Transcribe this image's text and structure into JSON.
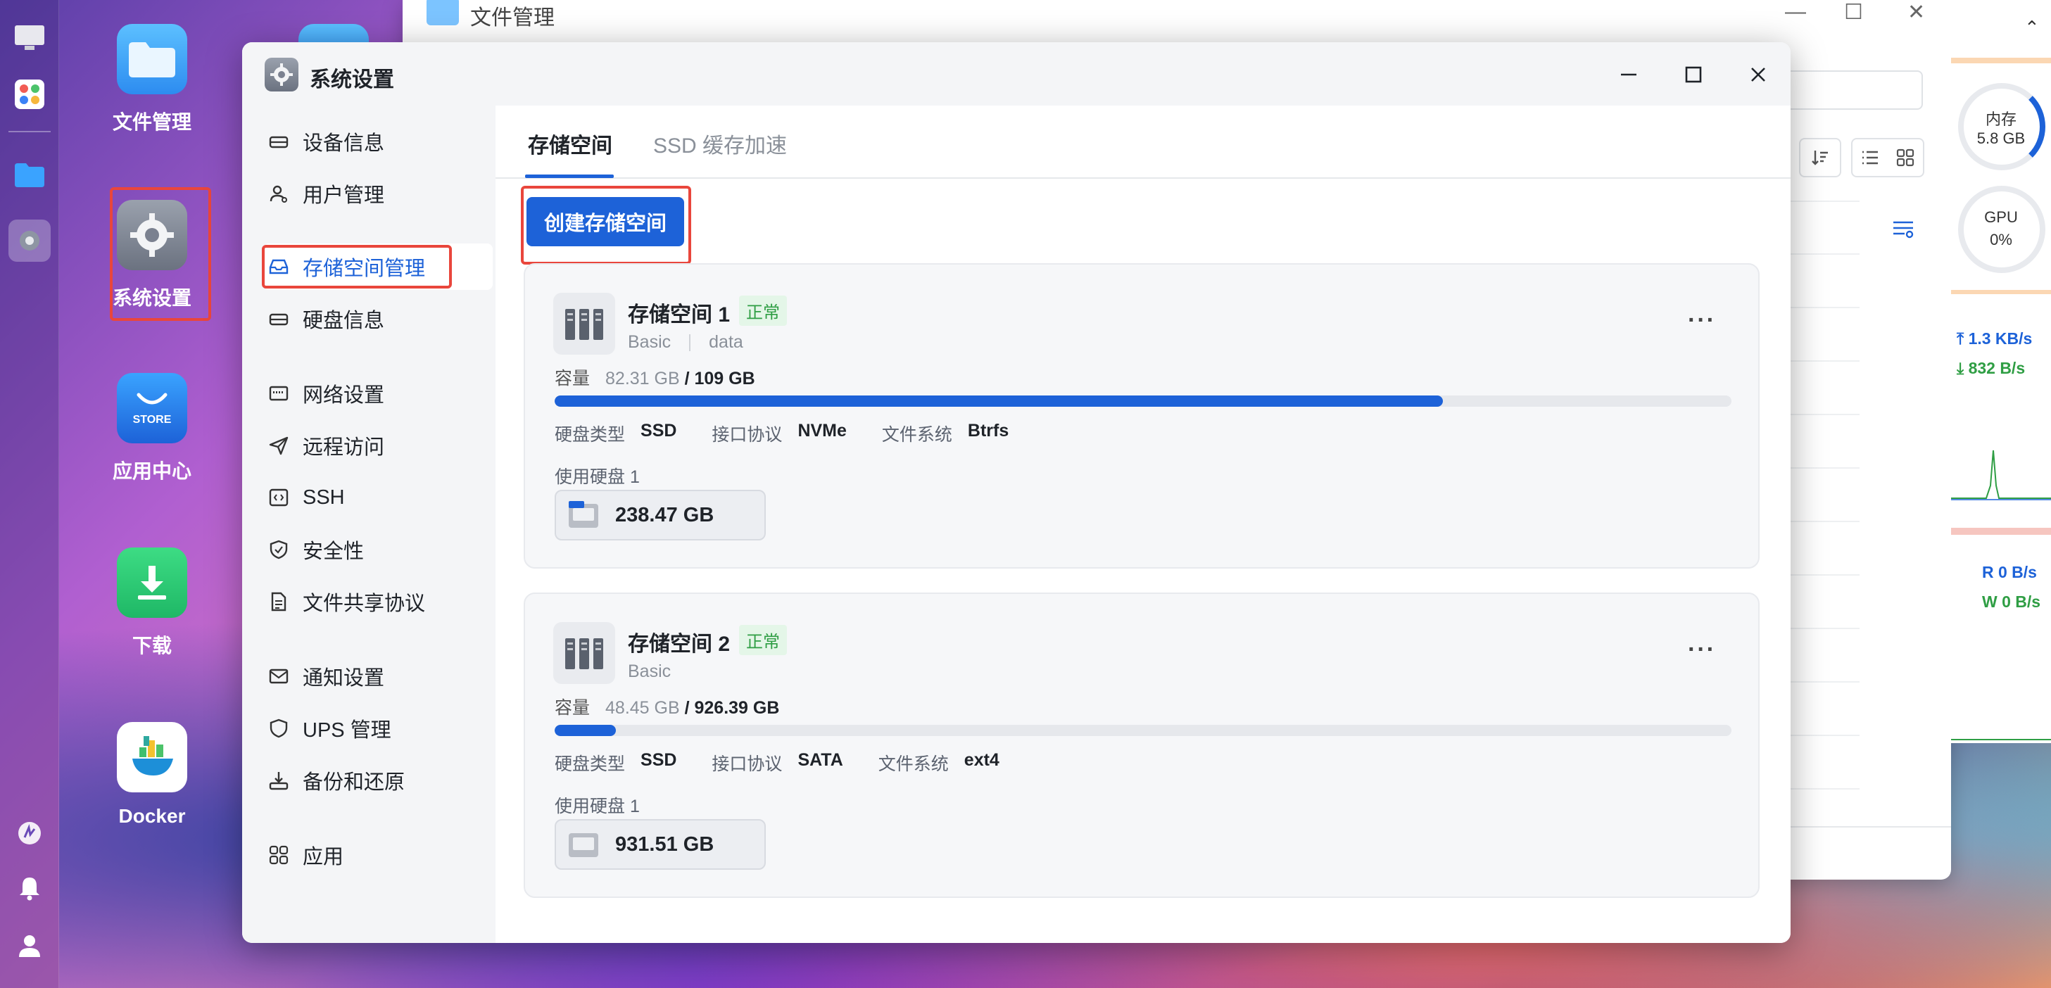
{
  "file_manager": {
    "title": "文件管理"
  },
  "desktop": {
    "icons": [
      {
        "label": "文件管理"
      },
      {
        "label": "系统设置"
      },
      {
        "label": "应用中心",
        "tile_text": "STORE"
      },
      {
        "label": "下载"
      },
      {
        "label": "Docker"
      }
    ]
  },
  "widgets": {
    "memory_label": "内存",
    "memory_value": "5.8 GB",
    "gpu_label": "GPU",
    "gpu_value": "0%",
    "upload_rate": "1.3 KB/s",
    "download_rate": "832 B/s",
    "read_rate": "R  0 B/s",
    "write_rate": "W  0 B/s",
    "colors": {
      "upload": "#1d62d8",
      "download": "#2f9e44"
    }
  },
  "settings": {
    "title": "系统设置",
    "nav": [
      {
        "label": "设备信息",
        "icon": "device-icon"
      },
      {
        "label": "用户管理",
        "icon": "user-icon"
      },
      {
        "label": "存储空间管理",
        "icon": "storage-icon"
      },
      {
        "label": "硬盘信息",
        "icon": "disk-icon"
      },
      {
        "label": "网络设置",
        "icon": "network-icon"
      },
      {
        "label": "远程访问",
        "icon": "send-icon"
      },
      {
        "label": "SSH",
        "icon": "ssh-icon"
      },
      {
        "label": "安全性",
        "icon": "shield-icon"
      },
      {
        "label": "文件共享协议",
        "icon": "file-icon"
      },
      {
        "label": "通知设置",
        "icon": "mail-icon"
      },
      {
        "label": "UPS 管理",
        "icon": "ups-icon"
      },
      {
        "label": "备份和还原",
        "icon": "backup-icon"
      },
      {
        "label": "应用",
        "icon": "apps-icon"
      }
    ],
    "active_nav": "存储空间管理",
    "tabs": [
      {
        "label": "存储空间"
      },
      {
        "label": "SSD 缓存加速"
      }
    ],
    "create_button": "创建存储空间",
    "pools": [
      {
        "name": "存储空间 1",
        "status": "正常",
        "raid": "Basic",
        "volume": "data",
        "capacity_label": "容量",
        "used": "82.31 GB",
        "total": "/ 109 GB",
        "usage_fraction": 0.755,
        "disk_type_label": "硬盘类型",
        "disk_type": "SSD",
        "interface_label": "接口协议",
        "interface": "NVMe",
        "fs_label": "文件系统",
        "fs": "Btrfs",
        "disks_label": "使用硬盘 1",
        "disk_size": "238.47 GB"
      },
      {
        "name": "存储空间 2",
        "status": "正常",
        "raid": "Basic",
        "capacity_label": "容量",
        "used": "48.45 GB",
        "total": "/ 926.39 GB",
        "usage_fraction": 0.052,
        "disk_type_label": "硬盘类型",
        "disk_type": "SSD",
        "interface_label": "接口协议",
        "interface": "SATA",
        "fs_label": "文件系统",
        "fs": "ext4",
        "disks_label": "使用硬盘 1",
        "disk_size": "931.51 GB"
      }
    ]
  }
}
